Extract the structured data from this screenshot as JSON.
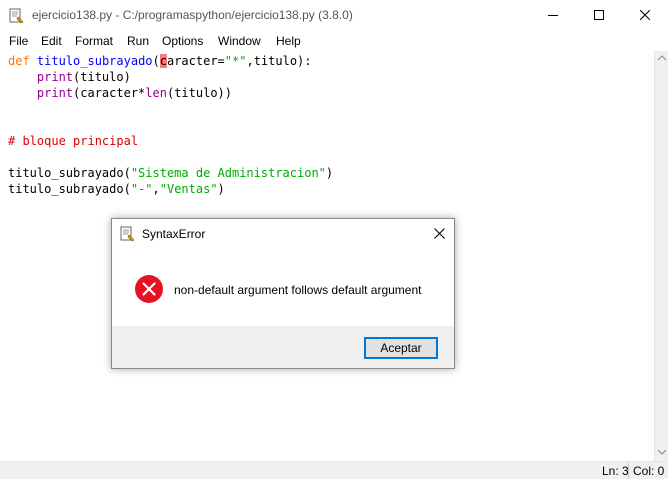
{
  "window": {
    "title": "ejercicio138.py - C:/programaspython/ejercicio138.py (3.8.0)",
    "minimize_icon": "minimize-icon",
    "maximize_icon": "maximize-icon",
    "close_icon": "close-icon"
  },
  "menu": {
    "items": [
      "File",
      "Edit",
      "Format",
      "Run",
      "Options",
      "Window",
      "Help"
    ]
  },
  "editor": {
    "lines": [
      {
        "tokens": [
          {
            "t": "def",
            "c": "kw"
          },
          {
            "t": " ",
            "c": ""
          },
          {
            "t": "titulo_subrayado",
            "c": "fn"
          },
          {
            "t": "(",
            "c": ""
          },
          {
            "t": "c",
            "c": "cursor-err"
          },
          {
            "t": "aracter=",
            "c": ""
          },
          {
            "t": "\"*\"",
            "c": "str"
          },
          {
            "t": ",titulo):",
            "c": ""
          }
        ]
      },
      {
        "tokens": [
          {
            "t": "    ",
            "c": ""
          },
          {
            "t": "print",
            "c": "bi"
          },
          {
            "t": "(titulo)",
            "c": ""
          }
        ]
      },
      {
        "tokens": [
          {
            "t": "    ",
            "c": ""
          },
          {
            "t": "print",
            "c": "bi"
          },
          {
            "t": "(caracter*",
            "c": ""
          },
          {
            "t": "len",
            "c": "bi"
          },
          {
            "t": "(titulo))",
            "c": ""
          }
        ]
      },
      {
        "tokens": []
      },
      {
        "tokens": []
      },
      {
        "tokens": [
          {
            "t": "# bloque principal",
            "c": "cm"
          }
        ]
      },
      {
        "tokens": []
      },
      {
        "tokens": [
          {
            "t": "titulo_subrayado(",
            "c": ""
          },
          {
            "t": "\"Sistema de Administracion\"",
            "c": "str"
          },
          {
            "t": ")",
            "c": ""
          }
        ]
      },
      {
        "tokens": [
          {
            "t": "titulo_subrayado(",
            "c": ""
          },
          {
            "t": "\"-\"",
            "c": "str"
          },
          {
            "t": ",",
            "c": ""
          },
          {
            "t": "\"Ventas\"",
            "c": "str"
          },
          {
            "t": ")",
            "c": ""
          }
        ]
      }
    ],
    "colors": {
      "keyword": "#ff7700",
      "function_def": "#0000ff",
      "builtin": "#900090",
      "string": "#00aa00",
      "comment": "#dd0000",
      "error_highlight": "#ff7777"
    }
  },
  "statusbar": {
    "ln": "Ln: 3",
    "col": "Col: 0"
  },
  "dialog": {
    "title": "SyntaxError",
    "message": "non-default argument follows default argument",
    "button": "Aceptar",
    "icon": "error-icon",
    "error_color": "#e81123"
  }
}
